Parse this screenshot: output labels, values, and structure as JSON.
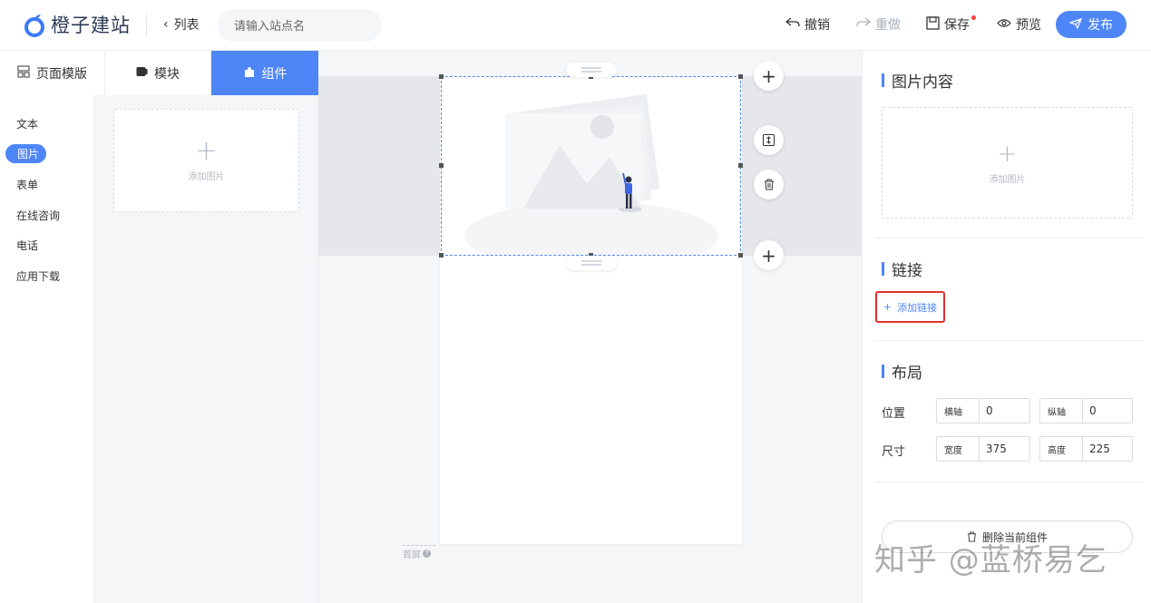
{
  "header": {
    "logo_text": "橙子建站",
    "back_label": "列表",
    "site_search_placeholder": "请输入站点名",
    "undo_label": "撤销",
    "redo_label": "重做",
    "save_label": "保存",
    "preview_label": "预览",
    "publish_label": "发布"
  },
  "left_tabs": [
    {
      "label": "页面模版",
      "icon": "template-icon",
      "active": false
    },
    {
      "label": "模块",
      "icon": "module-icon",
      "active": false
    },
    {
      "label": "组件",
      "icon": "puzzle-icon",
      "active": true
    }
  ],
  "categories": [
    {
      "label": "文本",
      "active": false
    },
    {
      "label": "图片",
      "active": true
    },
    {
      "label": "表单",
      "active": false
    },
    {
      "label": "在线咨询",
      "active": false
    },
    {
      "label": "电话",
      "active": false
    },
    {
      "label": "应用下载",
      "active": false
    }
  ],
  "components": {
    "add_image_label": "添加图片"
  },
  "canvas": {
    "fold_label": "首屏"
  },
  "right_panel": {
    "image_section_title": "图片内容",
    "image_upload_label": "添加图片",
    "link_section_title": "链接",
    "add_link_label": "添加链接",
    "layout_section_title": "布局",
    "position_label": "位置",
    "x_axis_label": "横轴",
    "x_axis_value": "0",
    "y_axis_label": "纵轴",
    "y_axis_value": "0",
    "size_label": "尺寸",
    "width_label": "宽度",
    "width_value": "375",
    "height_label": "高度",
    "height_value": "225",
    "delete_label": "删除当前组件"
  },
  "watermark": "知乎 @蓝桥易乞",
  "colors": {
    "accent": "#4e86f7",
    "highlight_border": "#e03030"
  }
}
